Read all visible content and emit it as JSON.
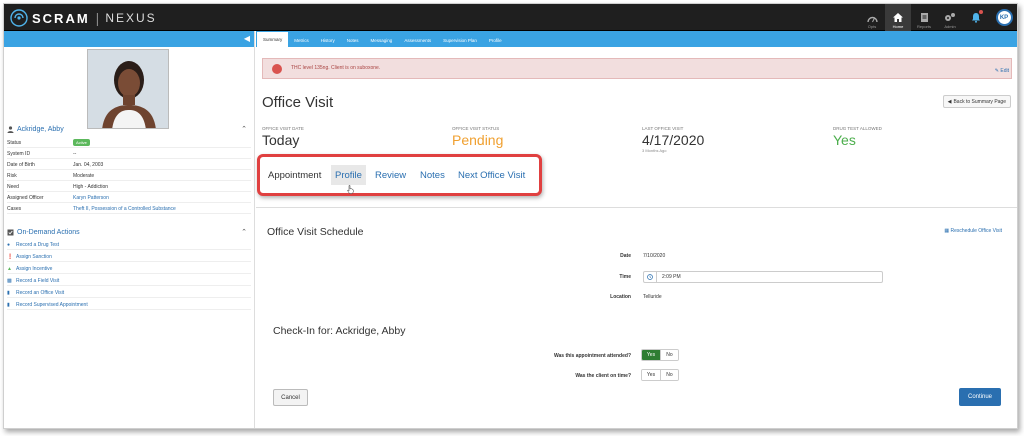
{
  "header": {
    "brand": "SCRAM",
    "product": "NEXUS",
    "nav": [
      {
        "label": "Opts",
        "icon": "dashboard-icon"
      },
      {
        "label": "Home",
        "icon": "home-icon"
      },
      {
        "label": "Reports",
        "icon": "reports-icon"
      },
      {
        "label": "Admin",
        "icon": "gears-icon"
      }
    ],
    "user_initials": "KP"
  },
  "tabs": [
    "Summary",
    "Metrics",
    "History",
    "Notes",
    "Messaging",
    "Assessments",
    "Supervision Plan",
    "Profile"
  ],
  "client": {
    "name": "Ackridge, Abby",
    "fields": [
      {
        "label": "Status",
        "value": "Active"
      },
      {
        "label": "System ID",
        "value": "--"
      },
      {
        "label": "Date of Birth",
        "value": "Jan. 04, 2003"
      },
      {
        "label": "Risk",
        "value": "Moderate"
      },
      {
        "label": "Need",
        "value": "High - Addiction"
      },
      {
        "label": "Assigned Officer",
        "value": "Karyn Patterson"
      },
      {
        "label": "Cases",
        "value": "Theft II, Possession of a Controlled Substance"
      }
    ]
  },
  "actions": {
    "title": "On-Demand Actions",
    "items": [
      "Record a Drug Test",
      "Assign Sanction",
      "Assign Incentive",
      "Record a Field Visit",
      "Record an Office Visit",
      "Record Supervised Appointment"
    ]
  },
  "alert": {
    "text": "THC level 135ng. Client is on suboxone.",
    "edit_label": "Edit"
  },
  "page": {
    "title": "Office Visit",
    "back_label": "Back to Summary Page",
    "stats": [
      {
        "label": "Office Visit Date",
        "value": "Today",
        "color": "#333333"
      },
      {
        "label": "Office Visit Status",
        "value": "Pending",
        "color": "#f0a030"
      },
      {
        "label": "Last Office Visit",
        "value": "4/17/2020",
        "sub": "3 Months Ago",
        "color": "#333333"
      },
      {
        "label": "Drug Test Allowed",
        "value": "Yes",
        "color": "#4cae4c"
      }
    ],
    "subtabs": [
      "Appointment",
      "Profile",
      "Review",
      "Notes",
      "Next Office Visit"
    ]
  },
  "schedule": {
    "title": "Office Visit Schedule",
    "reschedule_label": "Reschedule Office Visit",
    "date_label": "Date",
    "date_value": "7/10/2020",
    "time_label": "Time",
    "time_value": "2:09 PM",
    "location_label": "Location",
    "location_value": "Telluride"
  },
  "checkin": {
    "title": "Check-In for: Ackridge, Abby",
    "q1": "Was this appointment attended?",
    "q2": "Was the client on time?",
    "yes": "Yes",
    "no": "No"
  },
  "buttons": {
    "cancel": "Cancel",
    "continue": "Continue"
  }
}
